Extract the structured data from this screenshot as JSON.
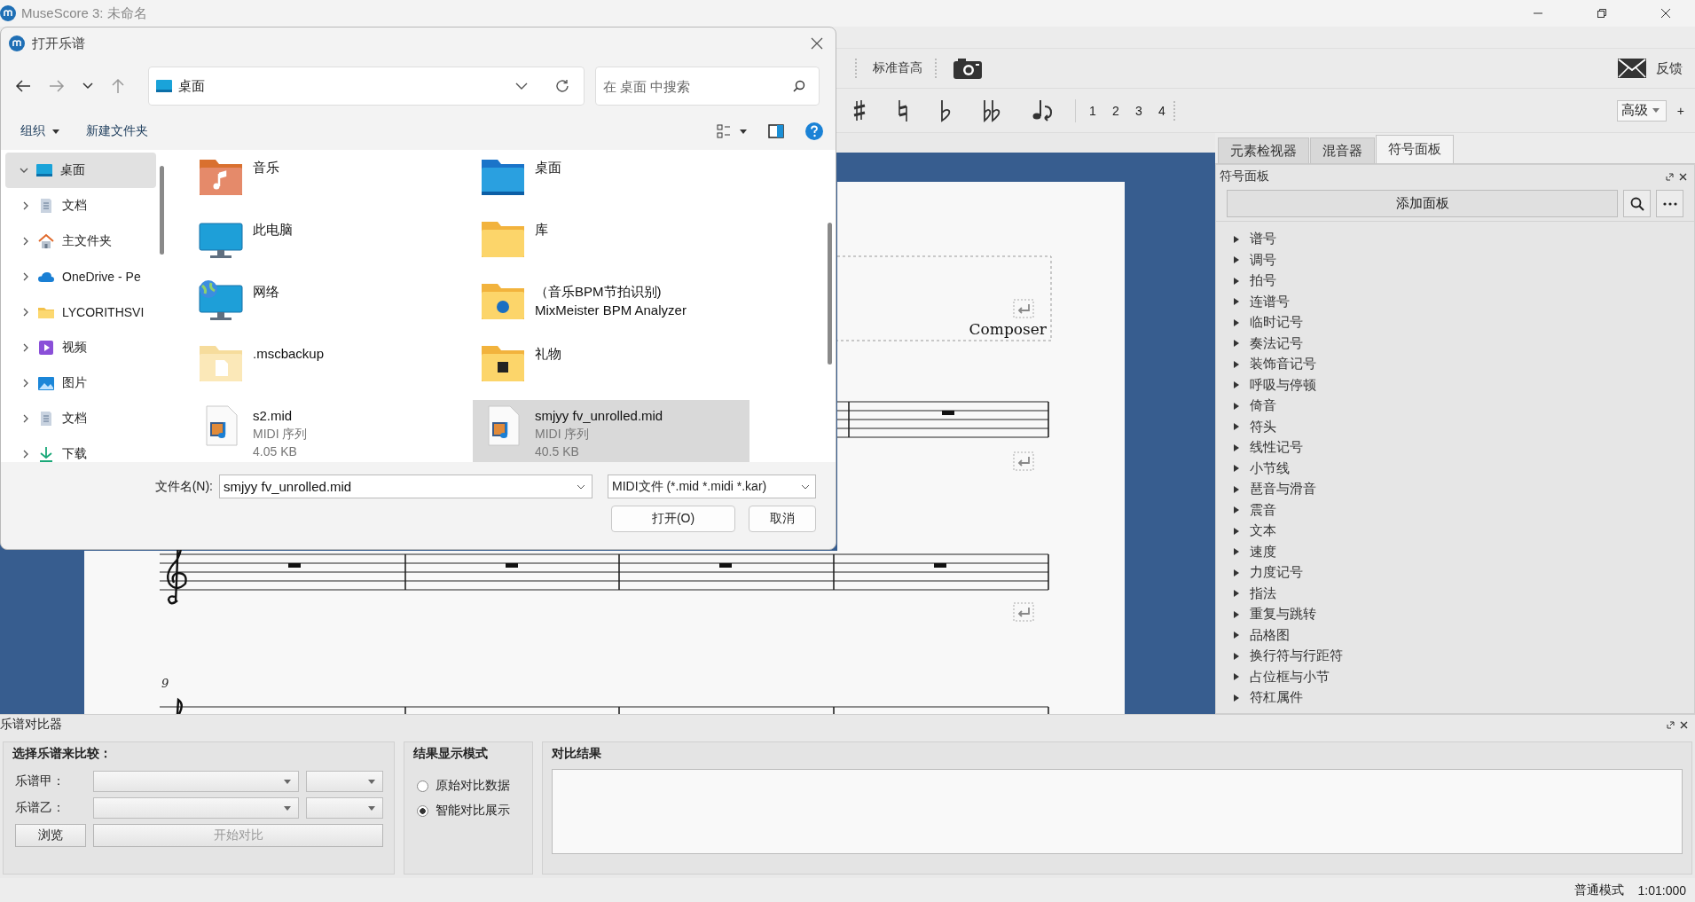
{
  "app_title": "MuseScore 3: 未命名",
  "toolbar": {
    "concert_pitch": "标准音高",
    "feedback": "反馈",
    "voices": [
      "1",
      "2",
      "3",
      "4"
    ],
    "workspace": "高级",
    "add": "+"
  },
  "score": {
    "composer": "Composer",
    "measure_number": "9"
  },
  "side_tabs": [
    {
      "label": "元素检视器",
      "selected": false
    },
    {
      "label": "混音器",
      "selected": false
    },
    {
      "label": "符号面板",
      "selected": true
    }
  ],
  "palette": {
    "title": "符号面板",
    "add_button": "添加面板",
    "items": [
      {
        "label": "谱号",
        "expanded": false
      },
      {
        "label": "调号",
        "expanded": false
      },
      {
        "label": "拍号",
        "expanded": false
      },
      {
        "label": "连谱号",
        "expanded": false
      },
      {
        "label": "临时记号",
        "expanded": false
      },
      {
        "label": "奏法记号",
        "expanded": false
      },
      {
        "label": "装饰音记号",
        "expanded": false
      },
      {
        "label": "呼吸与停顿",
        "expanded": false
      },
      {
        "label": "倚音",
        "expanded": false
      },
      {
        "label": "符头",
        "expanded": false
      },
      {
        "label": "线性记号",
        "expanded": false
      },
      {
        "label": "小节线",
        "expanded": false
      },
      {
        "label": "琶音与滑音",
        "expanded": false
      },
      {
        "label": "震音",
        "expanded": false
      },
      {
        "label": "文本",
        "expanded": false
      },
      {
        "label": "速度",
        "expanded": false
      },
      {
        "label": "力度记号",
        "expanded": false
      },
      {
        "label": "指法",
        "expanded": false
      },
      {
        "label": "重复与跳转",
        "expanded": false
      },
      {
        "label": "品格图",
        "expanded": false
      },
      {
        "label": "换行符与行距符",
        "expanded": false
      },
      {
        "label": "占位框与小节",
        "expanded": false
      },
      {
        "label": "符杠属件",
        "expanded": false
      }
    ]
  },
  "comparer": {
    "title": "乐谱对比器",
    "select_group": "选择乐谱来比较：",
    "score_a": "乐谱甲：",
    "score_b": "乐谱乙：",
    "buttons": [
      {
        "label": "浏览",
        "disabled": false
      },
      {
        "label": "开始对比",
        "disabled": true
      }
    ],
    "mode_group": "结果显示模式",
    "modes": [
      {
        "label": "原始对比数据",
        "selected": false
      },
      {
        "label": "智能对比展示",
        "selected": true
      }
    ],
    "result_group": "对比结果"
  },
  "status_bar": {
    "mode": "普通模式",
    "position": "1:01:000"
  },
  "dialog": {
    "title": "打开乐谱",
    "address": "桌面",
    "search_placeholder": "在 桌面 中搜索",
    "organize": "组织",
    "new_folder": "新建文件夹",
    "nav": [
      {
        "label": "桌面",
        "kind": "desktop",
        "expanded": true,
        "selected": true,
        "children": [
          {
            "label": "文档",
            "kind": "document",
            "expanded": false,
            "selected": false
          },
          {
            "label": "主文件夹",
            "kind": "home",
            "expanded": false,
            "selected": false
          },
          {
            "label": "OneDrive - Pe",
            "kind": "cloud",
            "expanded": false,
            "selected": false
          },
          {
            "label": "LYCORITHSVI",
            "kind": "folder",
            "expanded": false,
            "selected": false
          },
          {
            "label": "视频",
            "kind": "video",
            "expanded": false,
            "selected": false
          },
          {
            "label": "图片",
            "kind": "picture",
            "expanded": false,
            "selected": false
          },
          {
            "label": "文档",
            "kind": "document",
            "expanded": false,
            "selected": false
          },
          {
            "label": "下载",
            "kind": "download",
            "expanded": false,
            "selected": false
          }
        ]
      }
    ],
    "files": [
      {
        "name_lines": [
          "音乐"
        ],
        "kind": "music",
        "selected": false
      },
      {
        "name_lines": [
          "桌面"
        ],
        "kind": "desktop",
        "selected": false
      },
      {
        "name_lines": [
          "此电脑"
        ],
        "kind": "computer",
        "selected": false
      },
      {
        "name_lines": [
          "库"
        ],
        "kind": "folder",
        "selected": false
      },
      {
        "name_lines": [
          "网络"
        ],
        "kind": "network",
        "selected": false
      },
      {
        "name_lines": [
          "（音乐BPM节拍识别)",
          "MixMeister BPM Analyzer"
        ],
        "kind": "app",
        "selected": false
      },
      {
        "name_lines": [
          ".mscbackup"
        ],
        "kind": "faded",
        "selected": false
      },
      {
        "name_lines": [
          "礼物"
        ],
        "kind": "gift",
        "selected": false
      },
      {
        "name_lines": [
          "s2.mid"
        ],
        "kind": "midi",
        "details": [
          "MIDI 序列",
          "4.05 KB"
        ],
        "selected": false
      },
      {
        "name_lines": [
          "smjyy fv_unrolled.mid"
        ],
        "kind": "midi",
        "details": [
          "MIDI 序列",
          "40.5 KB"
        ],
        "selected": true
      }
    ],
    "filename_label": "文件名(N):",
    "filename": "smjyy fv_unrolled.mid",
    "filter": "MIDI文件 (*.mid *.midi *.kar)",
    "open": "打开(O)",
    "cancel": "取消"
  }
}
